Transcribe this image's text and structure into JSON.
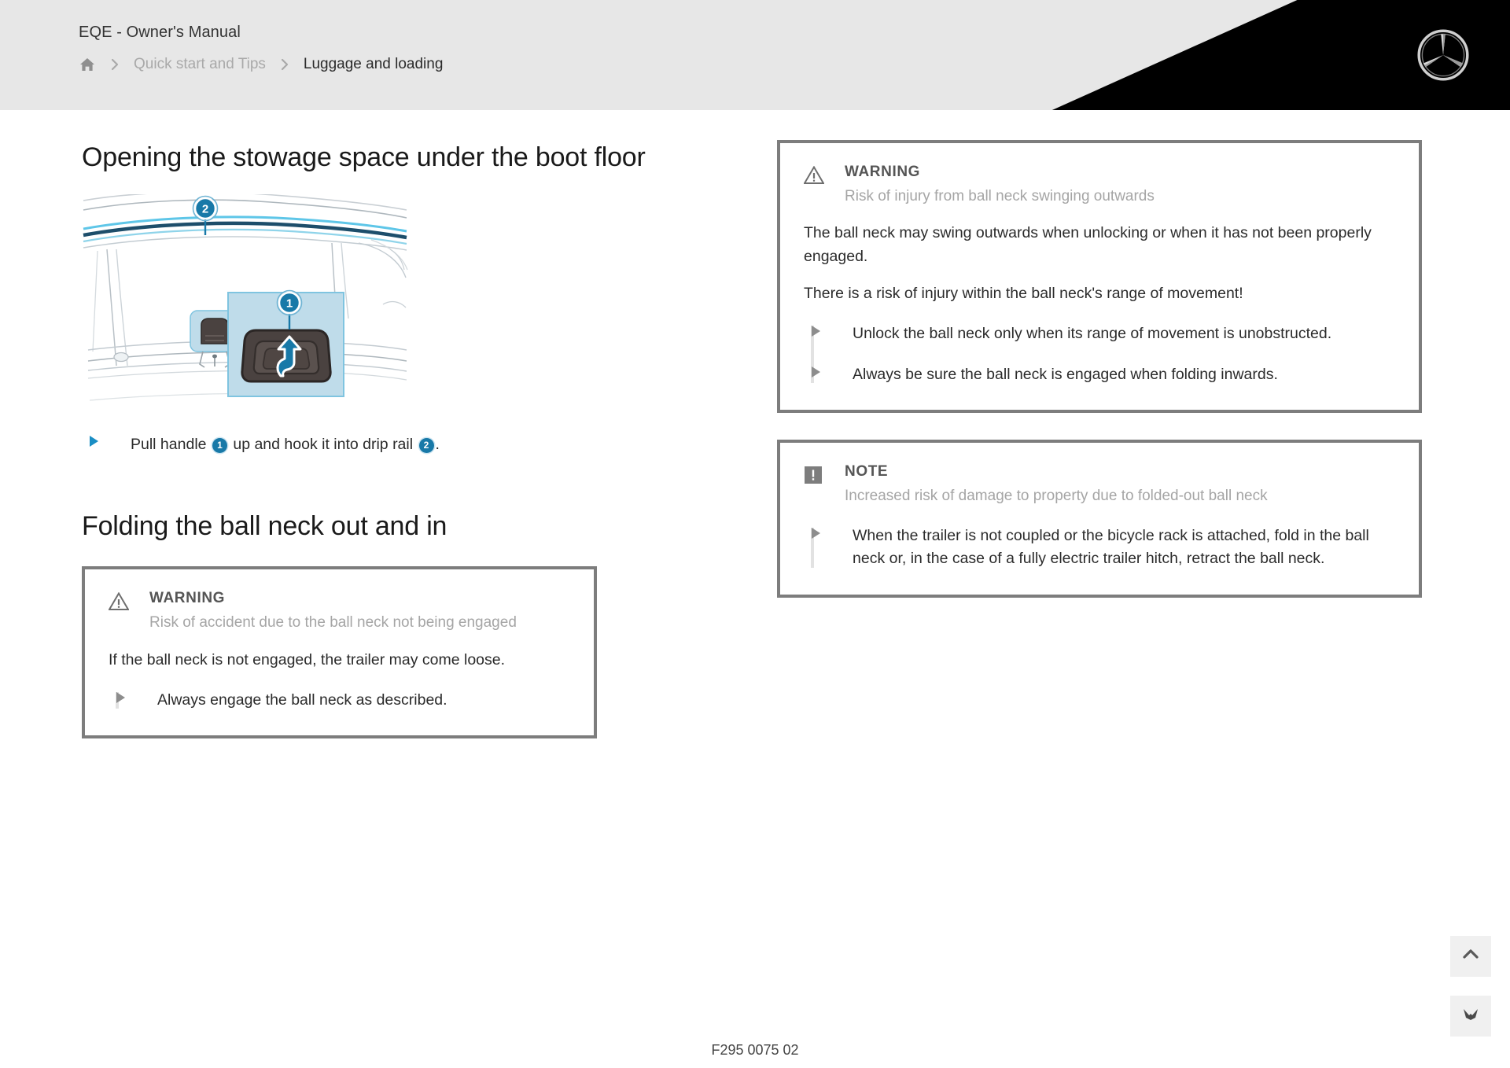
{
  "header": {
    "manual_title": "EQE - Owner's Manual",
    "breadcrumb": {
      "home_icon": "home-icon",
      "separator_icon": "chevron-right-icon",
      "parent": "Quick start and Tips",
      "current": "Luggage and loading"
    },
    "logo": "mercedes-benz-star-logo"
  },
  "left_column": {
    "section1": {
      "title": "Opening the stowage space under the boot floor",
      "figure": {
        "name": "boot-floor-stowage-illustration",
        "callout_1": "1",
        "callout_2": "2",
        "arrow_icon": "up-arrow-icon"
      },
      "step": {
        "marker_icon": "blue-triangle-bullet-icon",
        "text_before": "Pull handle",
        "badge_1": "1",
        "text_middle": "up and hook it into drip rail",
        "badge_2": "2",
        "text_after": "."
      }
    },
    "section2": {
      "title": "Folding the ball neck out and in",
      "warning": {
        "icon": "warning-triangle-icon",
        "label": "WARNING",
        "subtitle": "Risk of accident due to the ball neck not being engaged",
        "body": "If the ball neck is not engaged, the trailer may come loose.",
        "bullets": [
          "Always engage the ball neck as described."
        ]
      }
    }
  },
  "right_column": {
    "warning": {
      "icon": "warning-triangle-icon",
      "label": "WARNING",
      "subtitle": "Risk of injury from ball neck swinging outwards",
      "paragraphs": [
        "The ball neck may swing outwards when unlocking or when it has not been properly engaged.",
        "There is a risk of injury within the ball neck's range of movement!"
      ],
      "bullets": [
        "Unlock the ball neck only when its range of movement is unobstructed.",
        "Always be sure the ball neck is engaged when folding inwards."
      ]
    },
    "note": {
      "icon": "note-exclamation-icon",
      "label": "NOTE",
      "subtitle": "Increased risk of damage to property due to folded-out ball neck",
      "bullets": [
        "When the trailer is not coupled or the bicycle rack is attached, fold in the ball neck or, in the case of a fully electric trailer hitch, retract the ball neck."
      ]
    }
  },
  "controls": {
    "scroll_top_icon": "chevron-up-icon",
    "bookmark_icon": "bookmark-icon"
  },
  "footer": {
    "document_code": "F295 0075 02"
  },
  "colors": {
    "accent_blue": "#1879a8",
    "light_blue_panel": "#bfdcea",
    "header_grey": "#e7e7e7",
    "box_border": "#7d7d7d",
    "muted_text": "#a5a5a5"
  }
}
